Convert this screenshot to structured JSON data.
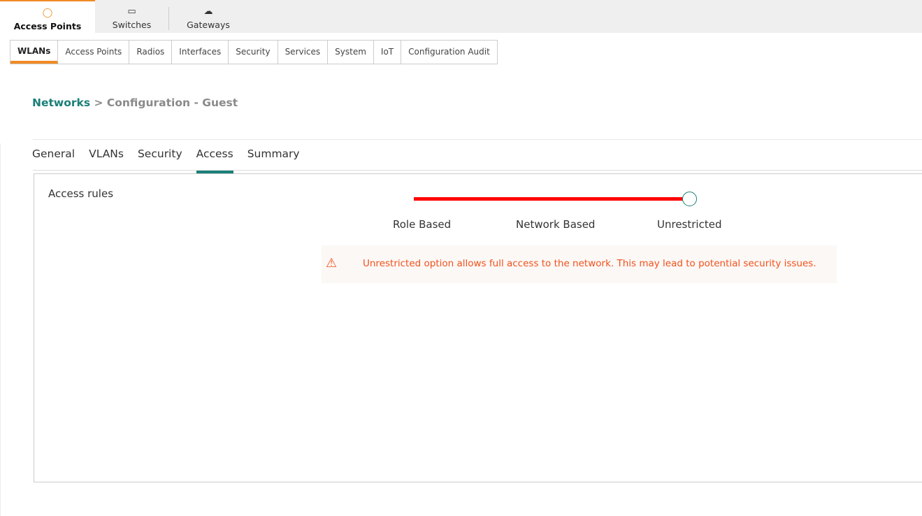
{
  "top_tabs": [
    {
      "label": "Access Points",
      "icon": "access-point-icon",
      "active": true
    },
    {
      "label": "Switches",
      "icon": "switch-icon"
    },
    {
      "label": "Gateways",
      "icon": "gateway-icon"
    }
  ],
  "subnav": [
    "WLANs",
    "Access Points",
    "Radios",
    "Interfaces",
    "Security",
    "Services",
    "System",
    "IoT",
    "Configuration Audit"
  ],
  "breadcrumb": {
    "link": "Networks",
    "sep": ">",
    "current": "Configuration - Guest"
  },
  "tabs": [
    "General",
    "VLANs",
    "Security",
    "Access",
    "Summary"
  ],
  "access": {
    "label": "Access rules",
    "options": [
      "Role Based",
      "Network Based",
      "Unrestricted"
    ],
    "selected": "Unrestricted",
    "slider_color": "#ff0000",
    "warning": "Unrestricted option allows full access to the network. This may lead to potential security issues."
  },
  "colors": {
    "accent": "#f08a24",
    "teal": "#1a7f78",
    "warning": "#f0521c"
  }
}
